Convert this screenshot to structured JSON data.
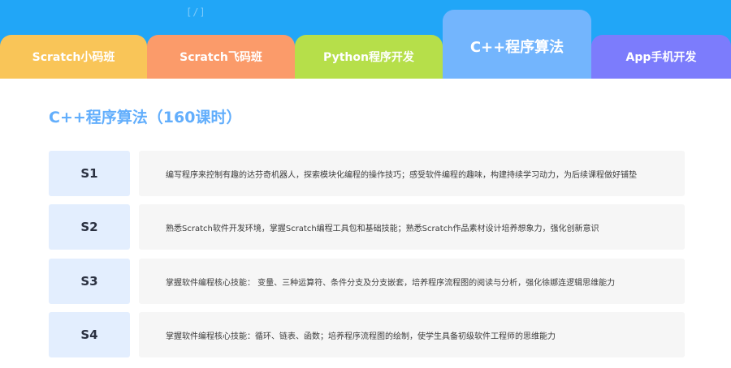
{
  "header": {
    "mark": "[/]",
    "colors": {
      "band": "#21a6f7"
    }
  },
  "tabs": [
    {
      "label": "Scratch小码班",
      "color": "#f9c558",
      "active": false
    },
    {
      "label": "Scratch飞码班",
      "color": "#fb9b6a",
      "active": false
    },
    {
      "label": "Python程序开发",
      "color": "#b6df4a",
      "active": false
    },
    {
      "label": "C++程序算法",
      "color": "#73b5fd",
      "active": true
    },
    {
      "label": "App手机开发",
      "color": "#7c7cfc",
      "active": false
    }
  ],
  "section": {
    "title": "C++程序算法（160课时）",
    "title_color": "#62aefc"
  },
  "levels": [
    {
      "code": "S1",
      "description": "编写程序来控制有趣的达芬奇机器人，探索模块化编程的操作技巧；感受软件编程的趣味，构建持续学习动力，为后续课程做好铺垫"
    },
    {
      "code": "S2",
      "description": "熟悉Scratch软件开发环境，掌握Scratch编程工具包和基础技能；熟悉Scratch作品素材设计培养想象力，强化创新意识"
    },
    {
      "code": "S3",
      "description": "掌握软件编程核心技能：  变量、三种运算符、条件分支及分支嵌套，培养程序流程图的阅读与分析，强化徐娜连逻辑思维能力"
    },
    {
      "code": "S4",
      "description": "掌握软件编程核心技能：循环、链表、函数；培养程序流程图的绘制，使学生具备初级软件工程师的思维能力"
    }
  ]
}
